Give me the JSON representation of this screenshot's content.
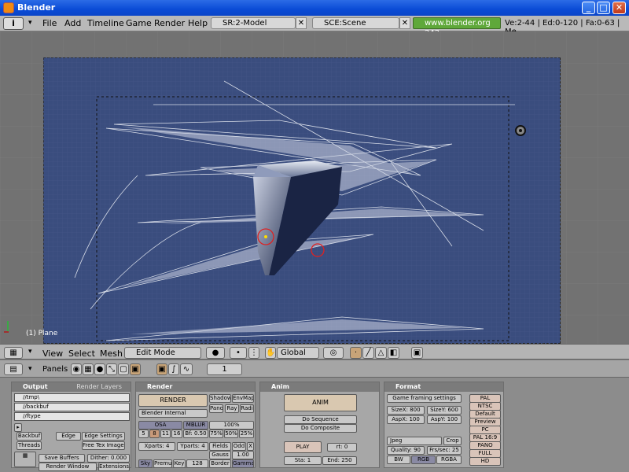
{
  "window": {
    "title": "Blender",
    "minimize": "_",
    "maximize": "□",
    "close": "✕"
  },
  "topmenu": {
    "items": [
      "File",
      "Add",
      "Timeline",
      "Game",
      "Render",
      "Help"
    ],
    "screen": "SR:2-Model",
    "scene": "SCE:Scene",
    "url": "www.blender.org 242",
    "stats": "Ve:2-44 | Ed:0-120 | Fa:0-63 | Me"
  },
  "viewport": {
    "object_label": "(1) Plane"
  },
  "view3d_header": {
    "menus": [
      "View",
      "Select",
      "Mesh"
    ],
    "mode": "Edit Mode",
    "orientation": "Global"
  },
  "buttons_header": {
    "panels_label": "Panels",
    "frame": "1"
  },
  "output_panel": {
    "tabs": [
      "Output",
      "Render Layers"
    ],
    "paths": [
      "//tmp\\",
      "//backbuf",
      "//ftype"
    ],
    "buttons": [
      "Backbuf",
      "Edge",
      "Edge Settings",
      "Threads",
      "Free Tex Images",
      "Save Buffers",
      "Dither: 0.000",
      "Render Window",
      "Extensions"
    ]
  },
  "render_panel": {
    "title": "Render",
    "render": "RENDER",
    "shadow": "Shadow",
    "envmap": "EnvMap",
    "pano": "Pano",
    "ray": "Ray",
    "radio": "Radi",
    "engine": "Blender Internal",
    "osa": "OSA",
    "mblur": "MBLUR",
    "osa_vals": [
      "5",
      "8",
      "11",
      "16"
    ],
    "bf": "Bf: 0.50",
    "pct": "100%",
    "pct_vals": [
      "75%",
      "50%",
      "25%"
    ],
    "xparts": "Xparts: 4",
    "yparts": "Yparts: 4",
    "fields": "Fields",
    "odd": "Odd",
    "x": "X",
    "gauss": "Gauss",
    "gauss_val": "1.00",
    "sky": "Sky",
    "premul": "Premul",
    "key": "Key",
    "key_val": "128",
    "border": "Border",
    "gamma": "Gamma"
  },
  "anim_panel": {
    "title": "Anim",
    "anim": "ANIM",
    "do_sequence": "Do Sequence",
    "do_composite": "Do Composite",
    "play": "PLAY",
    "rt": "rt: 0",
    "sta": "Sta: 1",
    "end": "End: 250"
  },
  "format_panel": {
    "title": "Format",
    "game_settings": "Game framing settings",
    "sizex": "SizeX: 800",
    "sizey": "SizeY: 600",
    "aspx": "AspX: 100",
    "aspy": "AspY: 100",
    "filetype": "Jpeg",
    "crop": "Crop",
    "quality": "Quality: 90",
    "frs": "Frs/sec: 25",
    "bw": "BW",
    "rgb": "RGB",
    "rgba": "RGBA",
    "presets": [
      "PAL",
      "NTSC",
      "Default",
      "Preview",
      "PC",
      "PAL 16:9",
      "PANO",
      "FULL",
      "HD"
    ]
  }
}
